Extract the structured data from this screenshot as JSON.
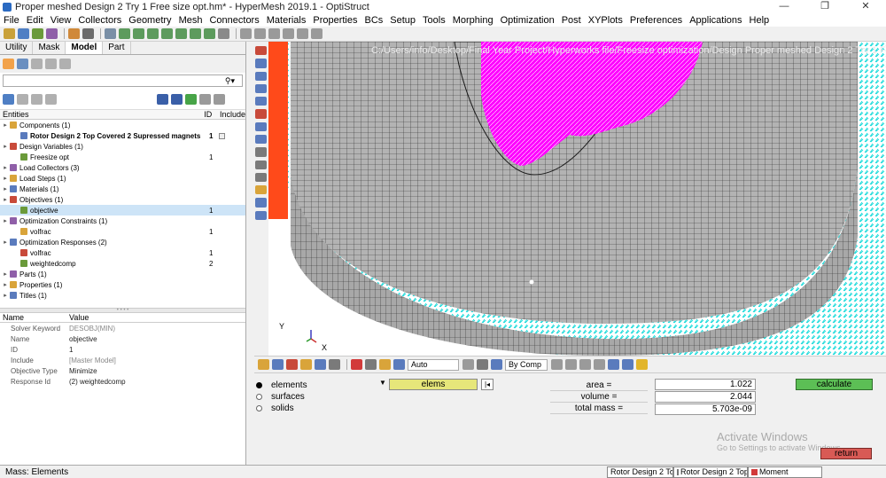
{
  "window": {
    "title": "Proper meshed Design 2 Try 1 Free size opt.hm* - HyperMesh 2019.1 - OptiStruct",
    "controls": [
      "—",
      "❐",
      "✕"
    ]
  },
  "menu": [
    "File",
    "Edit",
    "View",
    "Collectors",
    "Geometry",
    "Mesh",
    "Connectors",
    "Materials",
    "Properties",
    "BCs",
    "Setup",
    "Tools",
    "Morphing",
    "Optimization",
    "Post",
    "XYPlots",
    "Preferences",
    "Applications",
    "Help"
  ],
  "tabs": [
    "Utility",
    "Mask",
    "Model",
    "Part"
  ],
  "tree_header": {
    "entities": "Entities",
    "id": "ID",
    "include": "Include"
  },
  "tree": [
    {
      "label": "Components (1)",
      "level": 0,
      "exp": "▸"
    },
    {
      "label": "Rotor Design 2 Top Covered 2 Supressed magnets",
      "level": 1,
      "id": "1",
      "bold": true,
      "include": true
    },
    {
      "label": "Design Variables (1)",
      "level": 0,
      "exp": "▸"
    },
    {
      "label": "Freesize opt",
      "level": 1,
      "id": "1"
    },
    {
      "label": "Load Collectors (3)",
      "level": 0,
      "exp": "▸"
    },
    {
      "label": "Load Steps (1)",
      "level": 0,
      "exp": "▸"
    },
    {
      "label": "Materials (1)",
      "level": 0,
      "exp": "▸"
    },
    {
      "label": "Objectives (1)",
      "level": 0,
      "exp": "▸"
    },
    {
      "label": "objective",
      "level": 1,
      "id": "1",
      "selected": true
    },
    {
      "label": "Optimization Constraints (1)",
      "level": 0,
      "exp": "▸"
    },
    {
      "label": "volfrac",
      "level": 1,
      "id": "1"
    },
    {
      "label": "Optimization Responses (2)",
      "level": 0,
      "exp": "▸"
    },
    {
      "label": "volfrac",
      "level": 1,
      "id": "1"
    },
    {
      "label": "weightedcomp",
      "level": 1,
      "id": "2"
    },
    {
      "label": "Parts (1)",
      "level": 0,
      "exp": "▸"
    },
    {
      "label": "Properties (1)",
      "level": 0,
      "exp": "▸"
    },
    {
      "label": "Titles (1)",
      "level": 0,
      "exp": "▸"
    }
  ],
  "props_header": {
    "name": "Name",
    "value": "Value"
  },
  "props": [
    {
      "k": "Solver Keyword",
      "v": "DESOBJ(MIN)",
      "gray": true
    },
    {
      "k": "Name",
      "v": "objective"
    },
    {
      "k": "ID",
      "v": "1"
    },
    {
      "k": "Include",
      "v": "[Master Model]",
      "gray": true
    },
    {
      "k": "Objective Type",
      "v": "Minimize"
    },
    {
      "k": "Response Id",
      "v": "(2) weightedcomp"
    }
  ],
  "graphics": {
    "path": "C:/Users/info/Desktop/Final Year Project/Hyperworks file/Freesize optimization/Design Proper meshed Design 2 Try 1 Free size opt.hm",
    "axis_y": "Y",
    "axis_x": "X"
  },
  "bottom_toolbar": {
    "auto": "Auto",
    "bycomp": "By Comp"
  },
  "panel": {
    "radios": [
      "elements",
      "surfaces",
      "solids"
    ],
    "selector": "elems",
    "results": [
      {
        "label": "area =",
        "value": "1.022"
      },
      {
        "label": "volume =",
        "value": "2.044"
      },
      {
        "label": "total mass =",
        "value": "5.703e-09"
      }
    ],
    "calculate": "calculate",
    "return": "return",
    "activate1": "Activate Windows",
    "activate2": "Go to Settings to activate Windows."
  },
  "status": {
    "message": "Mass:  Elements",
    "box1": "Rotor Design 2 Top",
    "box2": "Rotor Design 2 Top",
    "box3": "Moment"
  },
  "colors": {
    "mesh_gray": "#a9a9a9",
    "magenta": "#ff00ff",
    "cyan": "#00e5e5",
    "orange": "#ff4a1a",
    "green": "#5cbf55",
    "red": "#d85a55"
  }
}
